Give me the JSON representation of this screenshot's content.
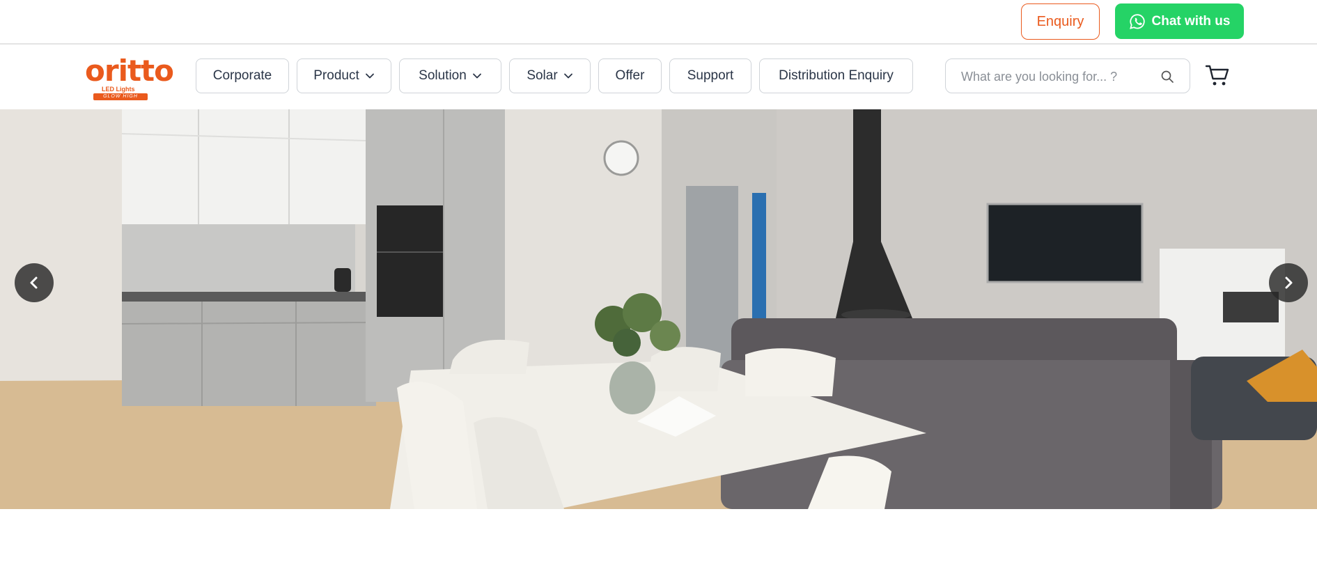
{
  "topbar": {
    "enquiry_label": "Enquiry",
    "chat_label": "Chat with us",
    "chat_icon": "whatsapp-icon"
  },
  "brand": {
    "name": "oritto",
    "subtitle": "LED Lights",
    "tagline": "GLOW HIGH",
    "color": "#ea5a1d"
  },
  "nav": {
    "items": [
      {
        "label": "Corporate",
        "has_dropdown": false
      },
      {
        "label": "Product",
        "has_dropdown": true
      },
      {
        "label": "Solution",
        "has_dropdown": true
      },
      {
        "label": "Solar",
        "has_dropdown": true
      },
      {
        "label": "Offer",
        "has_dropdown": false
      },
      {
        "label": "Support",
        "has_dropdown": false
      },
      {
        "label": "Distribution Enquiry",
        "has_dropdown": false
      }
    ]
  },
  "search": {
    "placeholder": "What are you looking for... ?",
    "value": ""
  },
  "cart": {
    "icon": "cart-icon"
  },
  "hero": {
    "image": "living-room-kitchen-photo",
    "prev_icon": "chevron-left-icon",
    "next_icon": "chevron-right-icon"
  },
  "colors": {
    "accent": "#ea5a1d",
    "whatsapp": "#25d366",
    "nav_text": "#2a3547",
    "border": "#cfd3d8"
  }
}
